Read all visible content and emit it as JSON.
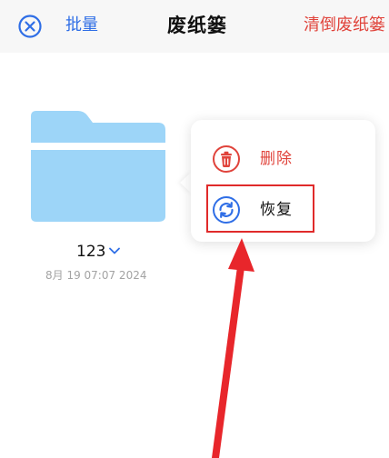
{
  "header": {
    "batch_label": "批量",
    "title": "废纸篓",
    "empty_label": "清倒废纸篓"
  },
  "folder": {
    "name": "123",
    "date": "8月 19 07:07 2024"
  },
  "context_menu": {
    "items": [
      {
        "label": "删除",
        "icon": "trash-icon"
      },
      {
        "label": "恢复",
        "icon": "restore-icon"
      }
    ]
  },
  "colors": {
    "accent_blue": "#2f6ee6",
    "destructive_red": "#e0433b",
    "folder_blue": "#9dd5f8",
    "annotation_red": "#e02a2a"
  }
}
